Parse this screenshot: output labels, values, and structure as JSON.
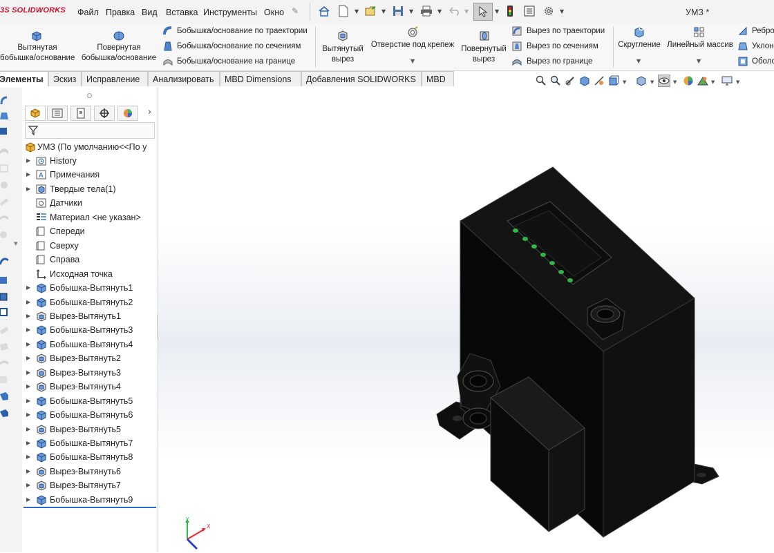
{
  "app": {
    "brand": "SOLIDWORKS",
    "logo_prefix": "3S",
    "document_title": "УМЗ *"
  },
  "menu": [
    "Файл",
    "Правка",
    "Вид",
    "Вставка",
    "Инструменты",
    "Окно"
  ],
  "ribbon": {
    "extruded_boss": [
      "Вытянутая",
      "бобышка/основание"
    ],
    "revolved_boss": [
      "Повернутая",
      "бобышка/основание"
    ],
    "boss_small": [
      "Бобышка/основание по траектории",
      "Бобышка/основание по сечениям",
      "Бобышка/основание на границе"
    ],
    "extruded_cut": [
      "Вытянутый",
      "вырез"
    ],
    "hole_wizard": "Отверстие под крепеж",
    "revolved_cut": [
      "Повернутый",
      "вырез"
    ],
    "cut_small": [
      "Вырез по траектории",
      "Вырез по сечениям",
      "Вырез по границе"
    ],
    "fillet": "Скругление",
    "linear_pattern": "Линейный массив",
    "right_small": [
      "Ребро",
      "Уклон",
      "Оболо"
    ]
  },
  "tabs": [
    "Элементы",
    "Эскиз",
    "Исправление",
    "Анализировать",
    "MBD Dimensions",
    "Добавления SOLIDWORKS",
    "MBD"
  ],
  "tree": {
    "root": "УМЗ  (По умолчанию<<По у",
    "items": [
      {
        "label": "History",
        "expandable": true,
        "icon": "history-folder-icon"
      },
      {
        "label": "Примечания",
        "expandable": true,
        "icon": "annotations-icon"
      },
      {
        "label": "Твердые тела(1)",
        "expandable": true,
        "icon": "solid-bodies-icon"
      },
      {
        "label": "Датчики",
        "expandable": false,
        "icon": "sensors-icon"
      },
      {
        "label": "Материал <не указан>",
        "expandable": false,
        "icon": "material-icon"
      },
      {
        "label": "Спереди",
        "expandable": false,
        "icon": "plane-icon"
      },
      {
        "label": "Сверху",
        "expandable": false,
        "icon": "plane-icon"
      },
      {
        "label": "Справа",
        "expandable": false,
        "icon": "plane-icon"
      },
      {
        "label": "Исходная точка",
        "expandable": false,
        "icon": "origin-icon"
      },
      {
        "label": "Бобышка-Вытянуть1",
        "expandable": true,
        "icon": "boss-extrude-icon"
      },
      {
        "label": "Бобышка-Вытянуть2",
        "expandable": true,
        "icon": "boss-extrude-icon"
      },
      {
        "label": "Вырез-Вытянуть1",
        "expandable": true,
        "icon": "cut-extrude-icon"
      },
      {
        "label": "Бобышка-Вытянуть3",
        "expandable": true,
        "icon": "boss-extrude-icon"
      },
      {
        "label": "Бобышка-Вытянуть4",
        "expandable": true,
        "icon": "boss-extrude-icon"
      },
      {
        "label": "Вырез-Вытянуть2",
        "expandable": true,
        "icon": "cut-extrude-icon"
      },
      {
        "label": "Вырез-Вытянуть3",
        "expandable": true,
        "icon": "cut-extrude-icon"
      },
      {
        "label": "Вырез-Вытянуть4",
        "expandable": true,
        "icon": "cut-extrude-icon"
      },
      {
        "label": "Бобышка-Вытянуть5",
        "expandable": true,
        "icon": "boss-extrude-icon"
      },
      {
        "label": "Бобышка-Вытянуть6",
        "expandable": true,
        "icon": "boss-extrude-icon"
      },
      {
        "label": "Вырез-Вытянуть5",
        "expandable": true,
        "icon": "cut-extrude-icon"
      },
      {
        "label": "Бобышка-Вытянуть7",
        "expandable": true,
        "icon": "boss-extrude-icon"
      },
      {
        "label": "Бобышка-Вытянуть8",
        "expandable": true,
        "icon": "boss-extrude-icon"
      },
      {
        "label": "Вырез-Вытянуть6",
        "expandable": true,
        "icon": "cut-extrude-icon"
      },
      {
        "label": "Вырез-Вытянуть7",
        "expandable": true,
        "icon": "cut-extrude-icon"
      },
      {
        "label": "Бобышка-Вытянуть9",
        "expandable": true,
        "icon": "boss-extrude-icon"
      }
    ]
  },
  "triad": {
    "x": "X",
    "y": "Y",
    "z": "Z"
  },
  "colors": {
    "brand_red": "#c8102e",
    "model": "#0a0a0a",
    "led_green": "#2fb84a",
    "accent_blue": "#2a6ac9"
  }
}
